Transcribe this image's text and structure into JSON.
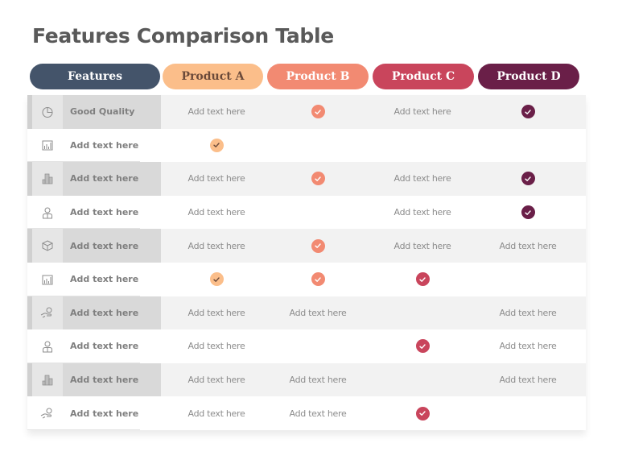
{
  "title": "Features Comparison Table",
  "header": {
    "features_label": "Features",
    "products": [
      {
        "name": "Product A",
        "bg": "#fbbe8a",
        "fg": "#6b4a3a"
      },
      {
        "name": "Product B",
        "bg": "#f28a72",
        "fg": "#ffffff"
      },
      {
        "name": "Product C",
        "bg": "#c9455c",
        "fg": "#ffffff"
      },
      {
        "name": "Product D",
        "bg": "#6a1f48",
        "fg": "#ffffff"
      }
    ],
    "features_bg": "#44546a",
    "features_fg": "#ffffff"
  },
  "check_colors": [
    "#fbbe8a",
    "#f28a72",
    "#c9455c",
    "#6a1f48"
  ],
  "check_mark_colors": [
    "#6b4a3a",
    "#ffffff",
    "#ffffff",
    "#ffffff"
  ],
  "rows": [
    {
      "icon": "pie-chart-icon",
      "label": "Good Quality",
      "cells": [
        {
          "type": "text",
          "value": "Add text here"
        },
        {
          "type": "check"
        },
        {
          "type": "text",
          "value": "Add text here"
        },
        {
          "type": "check"
        }
      ]
    },
    {
      "icon": "bar-chart-icon",
      "label": "Add text here",
      "cells": [
        {
          "type": "check"
        },
        {
          "type": "empty"
        },
        {
          "type": "empty"
        },
        {
          "type": "empty"
        }
      ]
    },
    {
      "icon": "buildings-icon",
      "label": "Add text here",
      "cells": [
        {
          "type": "text",
          "value": "Add text here"
        },
        {
          "type": "check"
        },
        {
          "type": "text",
          "value": "Add text here"
        },
        {
          "type": "check"
        }
      ]
    },
    {
      "icon": "person-icon",
      "label": "Add text here",
      "cells": [
        {
          "type": "text",
          "value": "Add text here"
        },
        {
          "type": "empty"
        },
        {
          "type": "text",
          "value": "Add text here"
        },
        {
          "type": "check"
        }
      ]
    },
    {
      "icon": "box-icon",
      "label": "Add text here",
      "cells": [
        {
          "type": "text",
          "value": "Add text here"
        },
        {
          "type": "check"
        },
        {
          "type": "text",
          "value": "Add text here"
        },
        {
          "type": "text",
          "value": "Add text here"
        }
      ]
    },
    {
      "icon": "bar-chart-icon",
      "label": "Add text here",
      "cells": [
        {
          "type": "check"
        },
        {
          "type": "check"
        },
        {
          "type": "check"
        },
        {
          "type": "empty"
        }
      ]
    },
    {
      "icon": "money-hand-icon",
      "label": "Add text here",
      "cells": [
        {
          "type": "text",
          "value": "Add text here"
        },
        {
          "type": "text",
          "value": "Add text here"
        },
        {
          "type": "empty"
        },
        {
          "type": "text",
          "value": "Add text here"
        }
      ]
    },
    {
      "icon": "person-icon",
      "label": "Add text here",
      "cells": [
        {
          "type": "text",
          "value": "Add text here"
        },
        {
          "type": "empty"
        },
        {
          "type": "check"
        },
        {
          "type": "text",
          "value": "Add text here"
        }
      ]
    },
    {
      "icon": "buildings-icon",
      "label": "Add text here",
      "cells": [
        {
          "type": "text",
          "value": "Add text here"
        },
        {
          "type": "text",
          "value": "Add text here"
        },
        {
          "type": "empty"
        },
        {
          "type": "text",
          "value": "Add text here"
        }
      ]
    },
    {
      "icon": "money-hand-icon",
      "label": "Add text here",
      "cells": [
        {
          "type": "text",
          "value": "Add text here"
        },
        {
          "type": "text",
          "value": "Add text here"
        },
        {
          "type": "check"
        },
        {
          "type": "empty"
        }
      ]
    }
  ]
}
